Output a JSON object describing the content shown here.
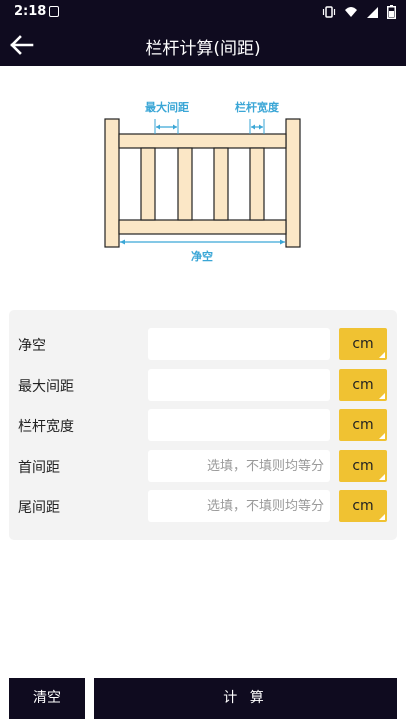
{
  "statusbar": {
    "time": "2:18"
  },
  "appbar": {
    "title": "栏杆计算(间距)"
  },
  "diagram": {
    "label_max_spacing": "最大间距",
    "label_baluster_width": "栏杆宽度",
    "label_clear_span": "净空"
  },
  "form": {
    "rows": [
      {
        "label": "净空",
        "value": "",
        "placeholder": "",
        "unit": "cm"
      },
      {
        "label": "最大间距",
        "value": "",
        "placeholder": "",
        "unit": "cm"
      },
      {
        "label": "栏杆宽度",
        "value": "",
        "placeholder": "",
        "unit": "cm"
      },
      {
        "label": "首间距",
        "value": "",
        "placeholder": "选填，不填则均等分",
        "unit": "cm"
      },
      {
        "label": "尾间距",
        "value": "",
        "placeholder": "选填，不填则均等分",
        "unit": "cm"
      }
    ]
  },
  "buttons": {
    "clear": "清空",
    "calculate": "计 算"
  },
  "colors": {
    "dark": "#0f0b1f",
    "accent": "#f0c232",
    "wood": "#fbe7c6",
    "dimension": "#3aa6d6"
  }
}
